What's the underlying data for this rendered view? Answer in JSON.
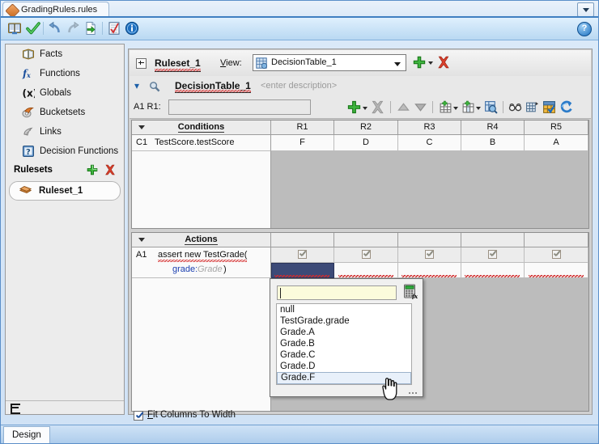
{
  "window": {
    "document_tab": "GradingRules.rules",
    "tab_menu_icon": "chevron-down-icon",
    "document_icon": "rules-diamond-icon"
  },
  "toolbar": {
    "icons": [
      {
        "name": "dictionary-icon",
        "title": "Dictionary"
      },
      {
        "name": "validate-check-icon",
        "title": "Validate"
      },
      {
        "name": "undo-icon",
        "title": "Undo"
      },
      {
        "name": "redo-icon",
        "title": "Redo"
      },
      {
        "name": "export-icon",
        "title": "Export"
      },
      {
        "name": "checklist-icon",
        "title": "Checklist"
      },
      {
        "name": "info-icon",
        "title": "Info"
      }
    ],
    "help_label": "?"
  },
  "sidebar": {
    "items": [
      {
        "label": "Facts",
        "icon": "facts-book-icon"
      },
      {
        "label": "Functions",
        "icon": "functions-fx-icon"
      },
      {
        "label": "Globals",
        "icon": "globals-x-icon"
      },
      {
        "label": "Bucketsets",
        "icon": "bucketsets-icon"
      },
      {
        "label": "Links",
        "icon": "links-icon"
      },
      {
        "label": "Decision Functions",
        "icon": "decision-functions-icon"
      }
    ],
    "rulesets_header": "Rulesets",
    "add_icon": "green-plus-icon",
    "delete_icon": "red-x-icon",
    "selected_ruleset": "Ruleset_1",
    "selected_ruleset_icon": "ruleset-icon",
    "collapse_icon": "collapse-pane-icon"
  },
  "editor": {
    "ruleset_name": "Ruleset_1",
    "expander_icon": "plus-box-icon",
    "view_label": "View:",
    "view_value": "DecisionTable_1",
    "view_value_icon": "decision-table-icon",
    "view_dropdown_icon": "chevron-down-icon",
    "add_view_icon": "green-plus-icon",
    "delete_view_icon": "red-x-icon",
    "table_chevron_icon": "double-chevron-down-icon",
    "table_search_icon": "magnifier-icon",
    "table_name": "DecisionTable_1",
    "table_description_placeholder": "<enter description>",
    "cell_label": "A1 R1:",
    "cell_value": "",
    "table_toolbar_icons": [
      {
        "name": "add-row-icon"
      },
      {
        "name": "delete-row-icon"
      },
      {
        "name": "move-up-icon"
      },
      {
        "name": "move-down-icon"
      },
      {
        "name": "insert-row-menu-icon"
      },
      {
        "name": "insert-column-menu-icon"
      },
      {
        "name": "find-gaps-icon"
      },
      {
        "name": "split-icon"
      },
      {
        "name": "compact-icon"
      },
      {
        "name": "merge-icon"
      },
      {
        "name": "refresh-icon"
      }
    ]
  },
  "conditions": {
    "title": "Conditions",
    "collapse_icon": "caret-down-icon",
    "rule_columns": [
      "R1",
      "R2",
      "R3",
      "R4",
      "R5"
    ],
    "rows": [
      {
        "id": "C1",
        "expression": "TestScore.testScore",
        "values": [
          "F",
          "D",
          "C",
          "B",
          "A"
        ]
      }
    ]
  },
  "actions": {
    "title": "Actions",
    "collapse_icon": "caret-down-icon",
    "rows": [
      {
        "id": "A1",
        "expression": "assert new TestGrade(",
        "param_name": "grade:",
        "param_type": "Grade",
        "param_close": ")",
        "checked": [
          true,
          true,
          true,
          true,
          true
        ],
        "values": [
          "",
          "",
          "",
          "",
          ""
        ]
      }
    ]
  },
  "popup": {
    "input_value": "",
    "calculator_icon": "expression-builder-icon",
    "options": [
      "null",
      "TestGrade.grade",
      "Grade.A",
      "Grade.B",
      "Grade.C",
      "Grade.D",
      "Grade.F"
    ],
    "selected_option": "Grade.F",
    "resize_grip_icon": "resize-grip-icon",
    "cursor_icon": "hand-pointer-cursor"
  },
  "footer": {
    "fit_columns_label": "Fit Columns To Width",
    "fit_columns_checked": true,
    "design_tab": "Design"
  },
  "colors": {
    "selection_navy": "#3c4a77",
    "accent_blue": "#3f7fc1",
    "error_red": "#d12b2b",
    "plus_green": "#2f9e2f",
    "delete_red": "#d43a2a"
  }
}
